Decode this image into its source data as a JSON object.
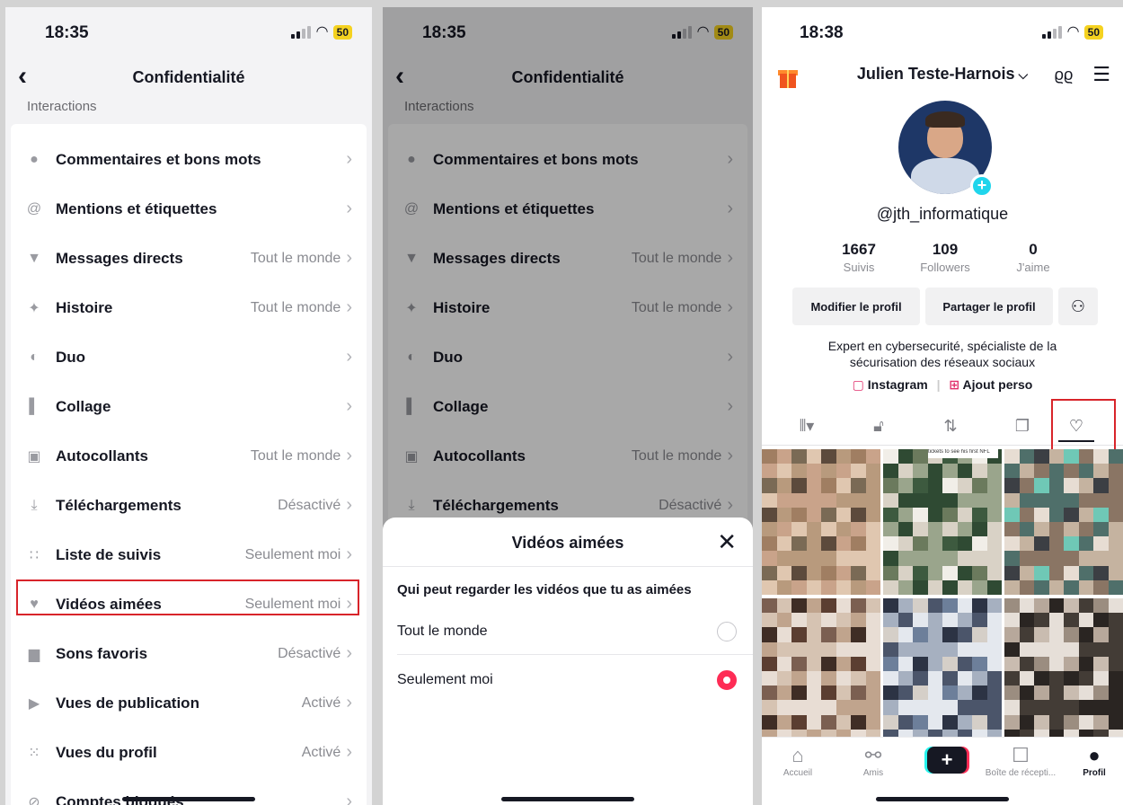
{
  "screen1": {
    "time": "18:35",
    "battery": "50",
    "title": "Confidentialité",
    "section": "Interactions",
    "rows": [
      {
        "label": "Commentaires et bons mots",
        "value": "",
        "icon": "comment-icon"
      },
      {
        "label": "Mentions et étiquettes",
        "value": "",
        "icon": "at-icon"
      },
      {
        "label": "Messages directs",
        "value": "Tout le monde",
        "icon": "send-icon"
      },
      {
        "label": "Histoire",
        "value": "Tout le monde",
        "icon": "sparkle-icon"
      },
      {
        "label": "Duo",
        "value": "",
        "icon": "duet-icon"
      },
      {
        "label": "Collage",
        "value": "",
        "icon": "stitch-icon"
      },
      {
        "label": "Autocollants",
        "value": "Tout le monde",
        "icon": "sticker-icon"
      },
      {
        "label": "Téléchargements",
        "value": "Désactivé",
        "icon": "download-icon"
      },
      {
        "label": "Liste de suivis",
        "value": "Seulement moi",
        "icon": "following-icon"
      },
      {
        "label": "Vidéos aimées",
        "value": "Seulement moi",
        "icon": "heart-icon"
      },
      {
        "label": "Sons favoris",
        "value": "Désactivé",
        "icon": "bookmark-icon"
      },
      {
        "label": "Vues de publication",
        "value": "Activé",
        "icon": "play-icon"
      },
      {
        "label": "Vues du profil",
        "value": "Activé",
        "icon": "footprints-icon"
      },
      {
        "label": "Comptes bloqués",
        "value": "",
        "icon": "blocked-icon"
      }
    ]
  },
  "screen2": {
    "time": "18:35",
    "battery": "50",
    "title": "Confidentialité",
    "section": "Interactions",
    "rows": [
      {
        "label": "Commentaires et bons mots",
        "value": ""
      },
      {
        "label": "Mentions et étiquettes",
        "value": ""
      },
      {
        "label": "Messages directs",
        "value": "Tout le monde"
      },
      {
        "label": "Histoire",
        "value": "Tout le monde"
      },
      {
        "label": "Duo",
        "value": ""
      },
      {
        "label": "Collage",
        "value": ""
      },
      {
        "label": "Autocollants",
        "value": "Tout le monde"
      },
      {
        "label": "Téléchargements",
        "value": "Désactivé"
      }
    ],
    "sheet": {
      "title": "Vidéos aimées",
      "question": "Qui peut regarder les vidéos que tu as aimées",
      "options": [
        {
          "label": "Tout le monde",
          "selected": false
        },
        {
          "label": "Seulement moi",
          "selected": true
        }
      ]
    }
  },
  "screen3": {
    "time": "18:38",
    "battery": "50",
    "profile_name": "Julien Teste-Harnois",
    "handle": "@jth_informatique",
    "stats": [
      {
        "num": "1667",
        "label": "Suivis"
      },
      {
        "num": "109",
        "label": "Followers"
      },
      {
        "num": "0",
        "label": "J'aime"
      }
    ],
    "buttons": {
      "edit": "Modifier le profil",
      "share": "Partager le profil"
    },
    "bio_line1": "Expert en cybersecurité, spécialiste de la",
    "bio_line2": "sécurisation des réseaux sociaux",
    "links": {
      "instagram": "Instagram",
      "add": "Ajout perso"
    },
    "tile_caption": "tickets to see his first NFL",
    "bottom_nav": [
      {
        "label": "Accueil"
      },
      {
        "label": "Amis"
      },
      {
        "label": "Boîte de récepti..."
      },
      {
        "label": "Profil"
      }
    ]
  },
  "colors": {
    "accent": "#fe2c55",
    "highlight_box": "#d8242a",
    "cyan": "#20d5ec"
  }
}
